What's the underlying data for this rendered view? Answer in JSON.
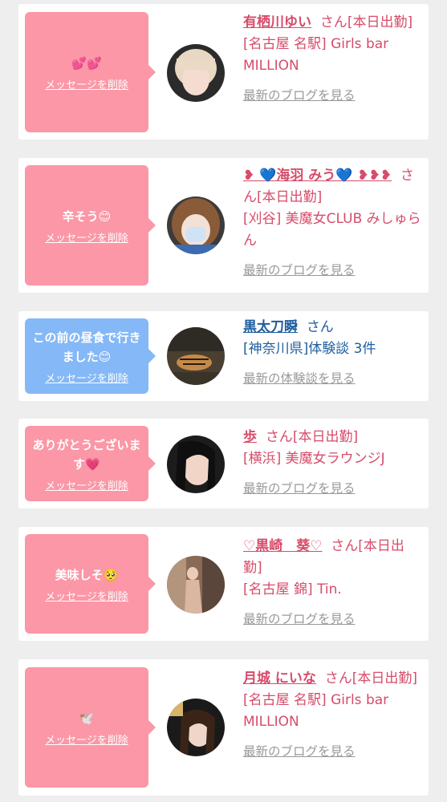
{
  "delete_label": "メッセージを削除",
  "items": [
    {
      "message": "💕💕",
      "name": "有栖川ゆい",
      "san": "さん",
      "status": "[本日出勤]",
      "shop": "[名古屋 名駅] Girls bar MILLION",
      "link": "最新のブログを見る"
    },
    {
      "message": "辛そう😊",
      "name": "❥ 💙海羽 みう💙 ❥❥❥",
      "san": "さん",
      "status": "[本日出勤]",
      "shop": "[刈谷] 美魔女CLUB みしゅらん",
      "link": "最新のブログを見る"
    },
    {
      "message": "この前の昼食で行きました😊",
      "name": "黒太刀瞬",
      "san": "さん",
      "status": "",
      "shop": "[神奈川県]体験談 3件",
      "link": "最新の体験談を見る"
    },
    {
      "message": "ありがとうございます💗",
      "name": "歩",
      "san": "さん",
      "status": "[本日出勤]",
      "shop": "[横浜] 美魔女ラウンジJ",
      "link": "最新のブログを見る"
    },
    {
      "message": "美味しそ🥺",
      "name": "♡黒崎　葵♡",
      "san": "さん",
      "status": "[本日出勤]",
      "shop": "[名古屋 錦] Tin.",
      "link": "最新のブログを見る"
    },
    {
      "message": "🕊️",
      "name": "月城 にいな",
      "san": "さん",
      "status": "[本日出勤]",
      "shop": "[名古屋 名駅] Girls bar MILLION",
      "link": "最新のブログを見る"
    }
  ]
}
